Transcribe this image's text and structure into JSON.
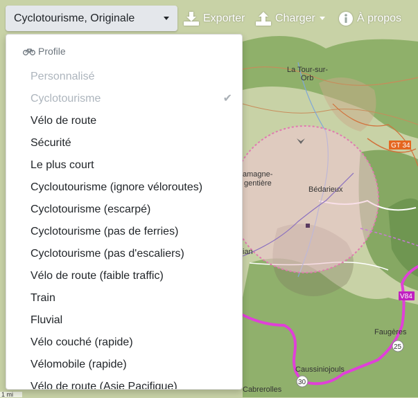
{
  "toolbar": {
    "profile_select_value": "Cyclotourisme, Originale",
    "export_label": "Exporter",
    "load_label": "Charger",
    "about_label": "À propos"
  },
  "dropdown": {
    "header": "Profile",
    "items": [
      {
        "label": "Personnalisé",
        "disabled": true
      },
      {
        "label": "Cyclotourisme",
        "disabled": true,
        "checked": true
      },
      {
        "label": "Vélo de route"
      },
      {
        "label": "Sécurité"
      },
      {
        "label": "Le plus court"
      },
      {
        "label": "Cycloutourisme (ignore véloroutes)"
      },
      {
        "label": "Cyclotourisme (escarpé)"
      },
      {
        "label": "Cyclotourisme (pas de ferries)"
      },
      {
        "label": "Cyclotourisme (pas d'escaliers)"
      },
      {
        "label": "Vélo de route (faible traffic)"
      },
      {
        "label": "Train"
      },
      {
        "label": "Fluvial"
      },
      {
        "label": "Vélo couché (rapide)"
      },
      {
        "label": "Vélomobile (rapide)"
      },
      {
        "label": "Vélo de route (Asie Pacifique)"
      }
    ]
  },
  "map_labels": {
    "town1": "La Tour-sur-",
    "town1b": "Orb",
    "bedarieux": "Bédarieux",
    "lamagne1": "amagne-",
    "lamagne2": "gentière",
    "faugeres": "Faugères",
    "caussiniojouls": "Caussiniojouls",
    "cabrerolles": "Cabrerolles",
    "gt34": "GT 34",
    "v84": "V84",
    "r25": "25",
    "r30": "30",
    "ian": "ian",
    "scale": "1 mi"
  },
  "colors": {
    "route": "#e040d8",
    "circle_fill": "#f2c4d4",
    "circle_stroke": "#e07ab0",
    "gt_badge": "#e5661f",
    "v84_badge": "#c020c0",
    "accent_text": "#212529"
  }
}
